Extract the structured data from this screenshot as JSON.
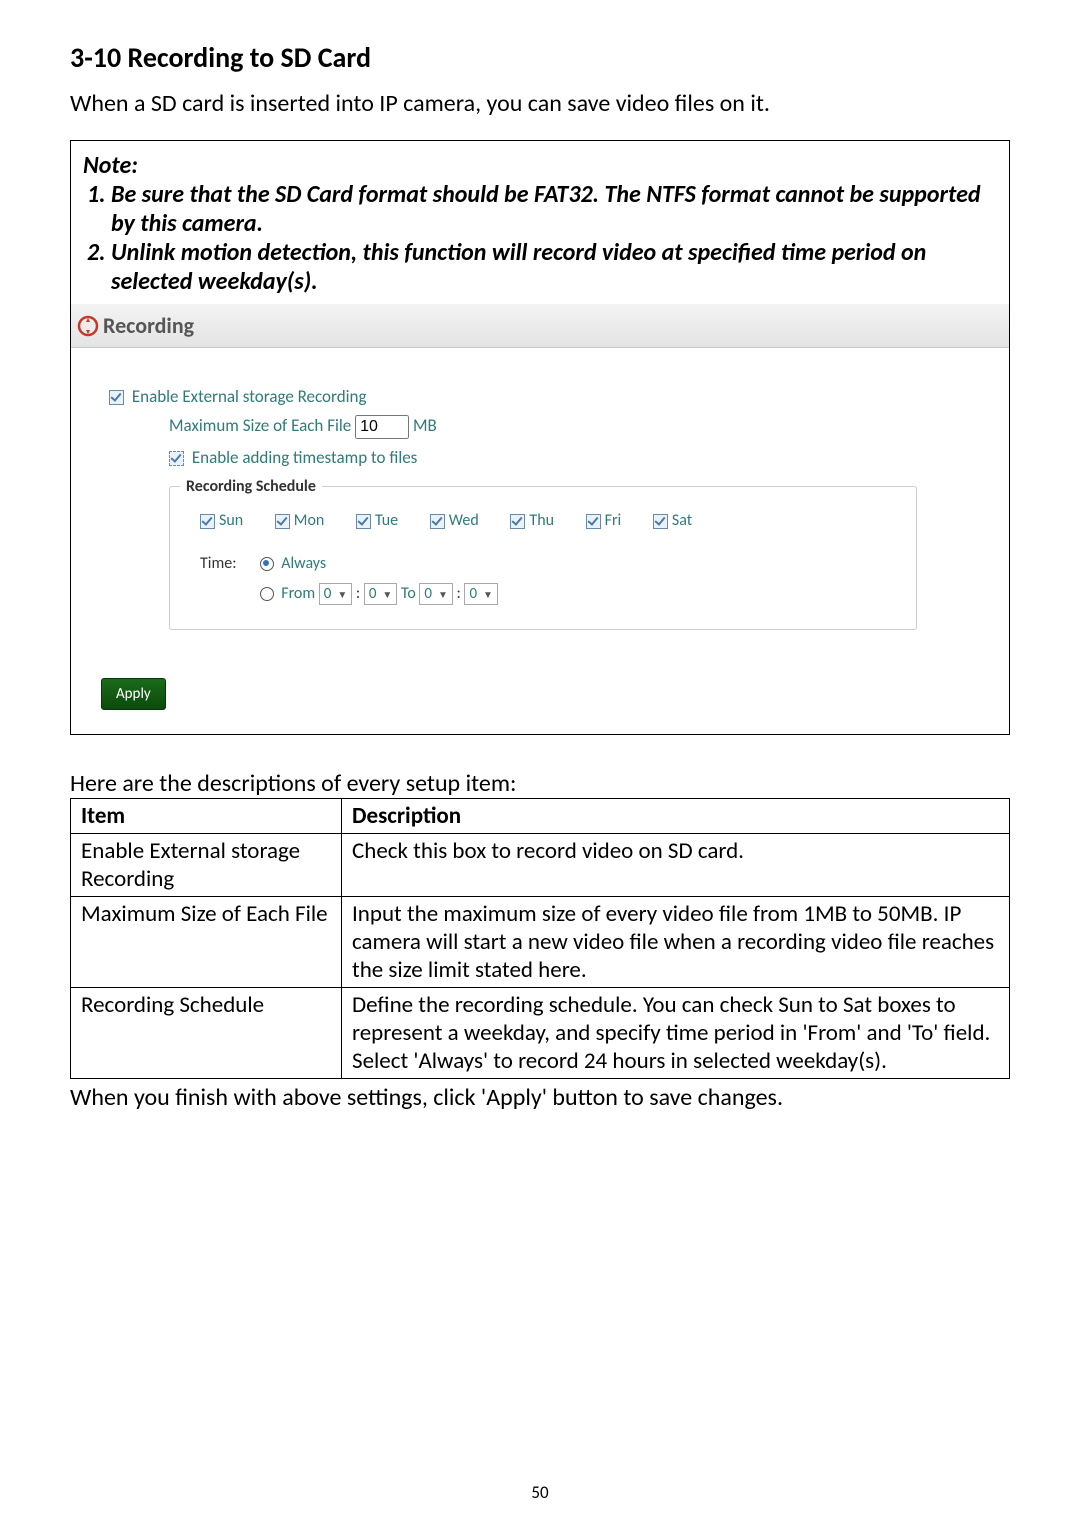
{
  "heading": "3-10 Recording to SD Card",
  "intro": "When a SD card is inserted into IP camera, you can save video files on it.",
  "note": {
    "title": "Note:",
    "items": [
      "Be sure that the SD Card format should be FAT32.    The NTFS format cannot be supported by this camera.",
      "Unlink motion detection, this function will record video at specified time period on selected weekday(s)."
    ]
  },
  "recording": {
    "title": "Recording",
    "enable_ext": "Enable External storage Recording",
    "max_label": "Maximum Size of Each File",
    "max_value": "10",
    "max_unit": "MB",
    "timestamp": "Enable adding timestamp to files",
    "schedule_title": "Recording Schedule",
    "days": [
      "Sun",
      "Mon",
      "Tue",
      "Wed",
      "Thu",
      "Fri",
      "Sat"
    ],
    "time_label": "Time:",
    "always": "Always",
    "from": "From",
    "to": "To",
    "h1": "0",
    "m1": "0",
    "h2": "0",
    "m2": "0",
    "apply": "Apply"
  },
  "table": {
    "intro": "Here are the descriptions of every setup item:",
    "headers": [
      "Item",
      "Description"
    ],
    "rows": [
      {
        "item": "Enable External storage Recording",
        "desc": "Check this box to record video on SD card."
      },
      {
        "item": "Maximum Size of Each File",
        "desc": "Input the maximum size of every video file from 1MB to 50MB. IP camera will start a new video file when a recording video file reaches the size limit stated here."
      },
      {
        "item": "Recording Schedule",
        "desc": "Define the recording schedule. You can check Sun to Sat boxes to represent a weekday, and specify time period in 'From' and 'To' field. Select 'Always' to record 24 hours in selected weekday(s)."
      }
    ]
  },
  "footer": "When you finish with above settings, click 'Apply' button to save changes.",
  "page_number": "50"
}
